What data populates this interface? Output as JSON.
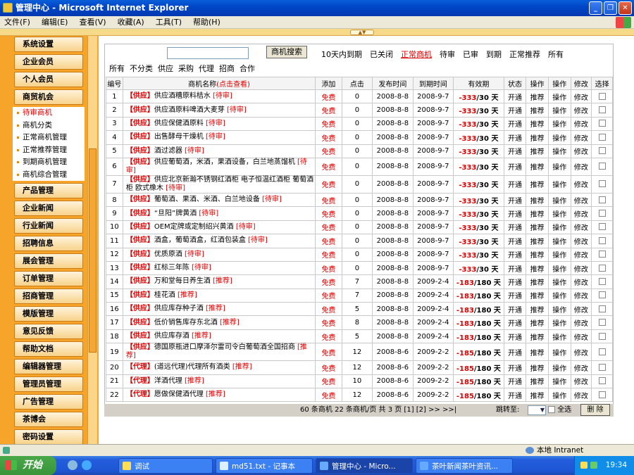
{
  "window": {
    "title": "管理中心 - Microsoft Internet Explorer"
  },
  "menu": [
    "文件(F)",
    "编辑(E)",
    "查看(V)",
    "收藏(A)",
    "工具(T)",
    "帮助(H)"
  ],
  "sidebar": {
    "before": [
      "系统设置",
      "企业会员",
      "个人会员",
      "商贸机会"
    ],
    "sub": [
      {
        "label": "待审商机",
        "active": true
      },
      {
        "label": "商机分类"
      },
      {
        "label": "正常商机管理"
      },
      {
        "label": "正常推荐管理"
      },
      {
        "label": "到期商机管理"
      },
      {
        "label": "商机综合管理"
      }
    ],
    "after": [
      "产品管理",
      "企业新闻",
      "行业新闻",
      "招聘信息",
      "展会管理",
      "订单管理",
      "招商管理",
      "模版管理",
      "意见反馈",
      "帮助文档",
      "编辑器管理",
      "管理员管理",
      "广告管理",
      "茶博会",
      "密码设置"
    ]
  },
  "toolbar": {
    "search_button": "商机搜索",
    "filters": [
      {
        "label": "10天内到期"
      },
      {
        "label": "已关闭"
      },
      {
        "label": "正常商机",
        "active": true
      },
      {
        "label": "待审"
      },
      {
        "label": "已审"
      },
      {
        "label": "到期"
      },
      {
        "label": "正常推荐"
      },
      {
        "label": "所有"
      }
    ]
  },
  "categories": [
    "所有",
    "不分类",
    "供应",
    "采购",
    "代理",
    "招商",
    "合作"
  ],
  "table": {
    "headers": {
      "no": "编号",
      "name": "商机名称",
      "name_link": "(点击查看)",
      "add": "添加",
      "clicks": "点击",
      "publish": "发布时间",
      "expire": "到期时间",
      "valid": "有效期",
      "status": "状态",
      "op1": "操作",
      "op2": "操作",
      "edit": "修改",
      "select": "选择"
    },
    "rows": [
      {
        "no": "1",
        "type": "【供应】",
        "title": "供应酒糟原料桔水",
        "tag": "[待审]",
        "add": "免费",
        "clicks": "0",
        "pub": "2008-8-8",
        "exp": "2008-9-7",
        "neg": "-333",
        "tot": "/30",
        "unit": "天",
        "status": "开通",
        "op1": "推荐",
        "op2": "操作",
        "edit": "修改"
      },
      {
        "no": "2",
        "type": "【供应】",
        "title": "供应酒原料啤酒大麦芽",
        "tag": "[待审]",
        "add": "免费",
        "clicks": "0",
        "pub": "2008-8-8",
        "exp": "2008-9-7",
        "neg": "-333",
        "tot": "/30",
        "unit": "天",
        "status": "开通",
        "op1": "推荐",
        "op2": "操作",
        "edit": "修改"
      },
      {
        "no": "3",
        "type": "【供应】",
        "title": "供应保健酒原料",
        "tag": "[待审]",
        "add": "免费",
        "clicks": "0",
        "pub": "2008-8-8",
        "exp": "2008-9-7",
        "neg": "-333",
        "tot": "/30",
        "unit": "天",
        "status": "开通",
        "op1": "推荐",
        "op2": "操作",
        "edit": "修改"
      },
      {
        "no": "4",
        "type": "【供应】",
        "title": "出售酵母干燥机",
        "tag": "[待审]",
        "add": "免费",
        "clicks": "0",
        "pub": "2008-8-8",
        "exp": "2008-9-7",
        "neg": "-333",
        "tot": "/30",
        "unit": "天",
        "status": "开通",
        "op1": "推荐",
        "op2": "操作",
        "edit": "修改"
      },
      {
        "no": "5",
        "type": "【供应】",
        "title": "酒过滤器",
        "tag": "[待审]",
        "add": "免费",
        "clicks": "0",
        "pub": "2008-8-8",
        "exp": "2008-9-7",
        "neg": "-333",
        "tot": "/30",
        "unit": "天",
        "status": "开通",
        "op1": "推荐",
        "op2": "操作",
        "edit": "修改"
      },
      {
        "no": "6",
        "type": "【供应】",
        "title": "供应葡萄酒，米酒，果酒设备，白兰地蒸馏机",
        "tag": "[待审]",
        "add": "免费",
        "clicks": "0",
        "pub": "2008-8-8",
        "exp": "2008-9-7",
        "neg": "-333",
        "tot": "/30",
        "unit": "天",
        "status": "开通",
        "op1": "推荐",
        "op2": "操作",
        "edit": "修改",
        "tall": true
      },
      {
        "no": "7",
        "type": "【供应】",
        "title": "供应北京新瀚不锈钢红酒柜 电子恒温红酒柜 葡萄酒柜 欧式橡木",
        "tag": "[待审]",
        "add": "免费",
        "clicks": "0",
        "pub": "2008-8-8",
        "exp": "2008-9-7",
        "neg": "-333",
        "tot": "/30",
        "unit": "天",
        "status": "开通",
        "op1": "推荐",
        "op2": "操作",
        "edit": "修改",
        "tall": true
      },
      {
        "no": "8",
        "type": "【供应】",
        "title": "葡萄酒、果酒、米酒、白兰地设备",
        "tag": "[待审]",
        "add": "免费",
        "clicks": "0",
        "pub": "2008-8-8",
        "exp": "2008-9-7",
        "neg": "-333",
        "tot": "/30",
        "unit": "天",
        "status": "开通",
        "op1": "推荐",
        "op2": "操作",
        "edit": "修改"
      },
      {
        "no": "9",
        "type": "【供应】",
        "title": "“旦阳”牌黄酒",
        "tag": "[待审]",
        "add": "免费",
        "clicks": "0",
        "pub": "2008-8-8",
        "exp": "2008-9-7",
        "neg": "-333",
        "tot": "/30",
        "unit": "天",
        "status": "开通",
        "op1": "推荐",
        "op2": "操作",
        "edit": "修改"
      },
      {
        "no": "10",
        "type": "【供应】",
        "title": "OEM定牌或定制绍兴黄酒",
        "tag": "[待审]",
        "add": "免费",
        "clicks": "0",
        "pub": "2008-8-8",
        "exp": "2008-9-7",
        "neg": "-333",
        "tot": "/30",
        "unit": "天",
        "status": "开通",
        "op1": "推荐",
        "op2": "操作",
        "edit": "修改"
      },
      {
        "no": "11",
        "type": "【供应】",
        "title": "酒盒，葡萄酒盒，红酒包装盒",
        "tag": "[待审]",
        "add": "免费",
        "clicks": "0",
        "pub": "2008-8-8",
        "exp": "2008-9-7",
        "neg": "-333",
        "tot": "/30",
        "unit": "天",
        "status": "开通",
        "op1": "推荐",
        "op2": "操作",
        "edit": "修改"
      },
      {
        "no": "12",
        "type": "【供应】",
        "title": "优质原酒",
        "tag": "[待审]",
        "add": "免费",
        "clicks": "0",
        "pub": "2008-8-8",
        "exp": "2008-9-7",
        "neg": "-333",
        "tot": "/30",
        "unit": "天",
        "status": "开通",
        "op1": "推荐",
        "op2": "操作",
        "edit": "修改"
      },
      {
        "no": "13",
        "type": "【供应】",
        "title": "红标三年陈",
        "tag": "[待审]",
        "add": "免费",
        "clicks": "0",
        "pub": "2008-8-8",
        "exp": "2008-9-7",
        "neg": "-333",
        "tot": "/30",
        "unit": "天",
        "status": "开通",
        "op1": "推荐",
        "op2": "操作",
        "edit": "修改"
      },
      {
        "no": "14",
        "type": "【供应】",
        "title": "万和堂每日养生酒",
        "tag": "[推荐]",
        "add": "免费",
        "clicks": "7",
        "pub": "2008-8-8",
        "exp": "2009-2-4",
        "neg": "-183",
        "tot": "/180",
        "unit": "天",
        "status": "开通",
        "op1": "推荐",
        "op2": "操作",
        "edit": "修改"
      },
      {
        "no": "15",
        "type": "【供应】",
        "title": "桂花酒",
        "tag": "[推荐]",
        "add": "免费",
        "clicks": "7",
        "pub": "2008-8-8",
        "exp": "2009-2-4",
        "neg": "-183",
        "tot": "/180",
        "unit": "天",
        "status": "开通",
        "op1": "推荐",
        "op2": "操作",
        "edit": "修改"
      },
      {
        "no": "16",
        "type": "【供应】",
        "title": "供应库存种子酒",
        "tag": "[推荐]",
        "add": "免费",
        "clicks": "5",
        "pub": "2008-8-8",
        "exp": "2009-2-4",
        "neg": "-183",
        "tot": "/180",
        "unit": "天",
        "status": "开通",
        "op1": "推荐",
        "op2": "操作",
        "edit": "修改"
      },
      {
        "no": "17",
        "type": "【供应】",
        "title": "低价销售库存东北酒",
        "tag": "[推荐]",
        "add": "免费",
        "clicks": "8",
        "pub": "2008-8-8",
        "exp": "2009-2-4",
        "neg": "-183",
        "tot": "/180",
        "unit": "天",
        "status": "开通",
        "op1": "推荐",
        "op2": "操作",
        "edit": "修改"
      },
      {
        "no": "18",
        "type": "【供应】",
        "title": "供应库存酒",
        "tag": "[推荐]",
        "add": "免费",
        "clicks": "5",
        "pub": "2008-8-8",
        "exp": "2009-2-4",
        "neg": "-183",
        "tot": "/180",
        "unit": "天",
        "status": "开通",
        "op1": "推荐",
        "op2": "操作",
        "edit": "修改"
      },
      {
        "no": "19",
        "type": "【供应】",
        "title": "德国原瓶进口摩泽尔雷司令白葡萄酒全国招商",
        "tag": "[推荐]",
        "add": "免费",
        "clicks": "12",
        "pub": "2008-8-6",
        "exp": "2009-2-2",
        "neg": "-185",
        "tot": "/180",
        "unit": "天",
        "status": "开通",
        "op1": "推荐",
        "op2": "操作",
        "edit": "修改",
        "tall": true
      },
      {
        "no": "20",
        "type": "【代理】",
        "title": "(道远代理)代理所有酒类",
        "tag": "[推荐]",
        "add": "免费",
        "clicks": "12",
        "pub": "2008-8-6",
        "exp": "2009-2-2",
        "neg": "-185",
        "tot": "/180",
        "unit": "天",
        "status": "开通",
        "op1": "推荐",
        "op2": "操作",
        "edit": "修改"
      },
      {
        "no": "21",
        "type": "【代理】",
        "title": "洋酒代理",
        "tag": "[推荐]",
        "add": "免费",
        "clicks": "10",
        "pub": "2008-8-6",
        "exp": "2009-2-2",
        "neg": "-185",
        "tot": "/180",
        "unit": "天",
        "status": "开通",
        "op1": "推荐",
        "op2": "操作",
        "edit": "修改"
      },
      {
        "no": "22",
        "type": "【代理】",
        "title": "愿做保健酒代理",
        "tag": "[推荐]",
        "add": "免费",
        "clicks": "12",
        "pub": "2008-8-6",
        "exp": "2009-2-2",
        "neg": "-185",
        "tot": "/180",
        "unit": "天",
        "status": "开通",
        "op1": "推荐",
        "op2": "操作",
        "edit": "修改"
      }
    ]
  },
  "pager": {
    "info": "60 条商机  22 条商机/页  共 3 页 [1] [2] >> >>|",
    "jump": "跳转至:",
    "select_all": "全选",
    "delete": "删 除"
  },
  "statusbar": {
    "zone": "本地 Intranet"
  },
  "taskbar": {
    "start": "开始",
    "tasks": [
      {
        "label": "调试"
      },
      {
        "label": "md51.txt - 记事本"
      },
      {
        "label": "管理中心 - Micro...",
        "active": true
      },
      {
        "label": "茶叶新闻茶叶资讯..."
      }
    ],
    "clock": "19:34"
  }
}
